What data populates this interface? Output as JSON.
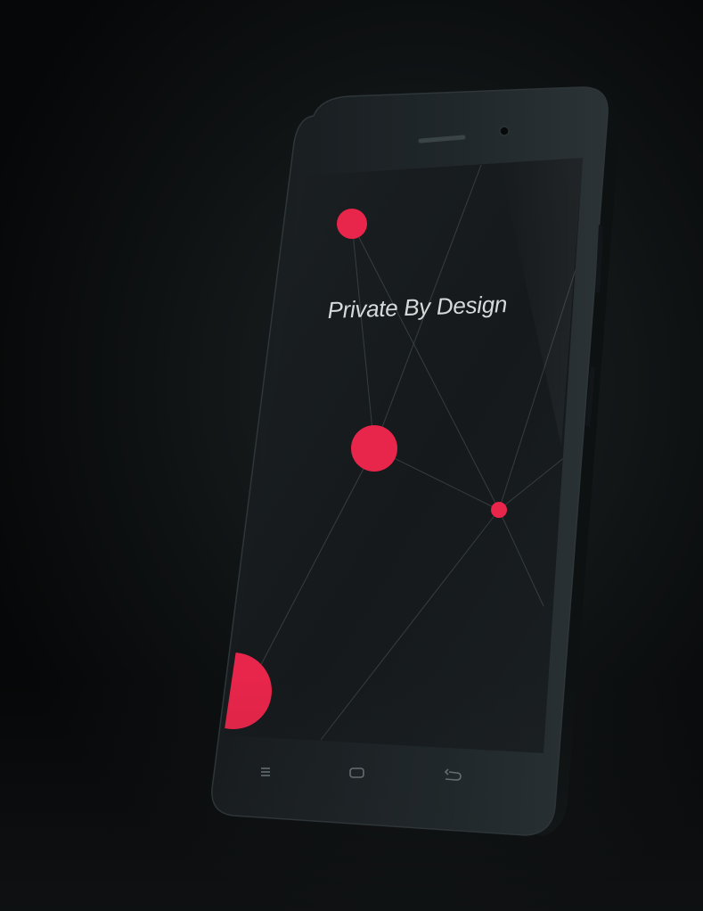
{
  "screen": {
    "tagline": "Private By Design"
  },
  "colors": {
    "accent": "#e8254a",
    "phone_body": "#1b2123",
    "screen_bg": "#15191b",
    "background": "#0b0d0e"
  },
  "nav_keys": [
    {
      "name": "menu-key-icon"
    },
    {
      "name": "home-key-icon"
    },
    {
      "name": "back-key-icon"
    }
  ]
}
